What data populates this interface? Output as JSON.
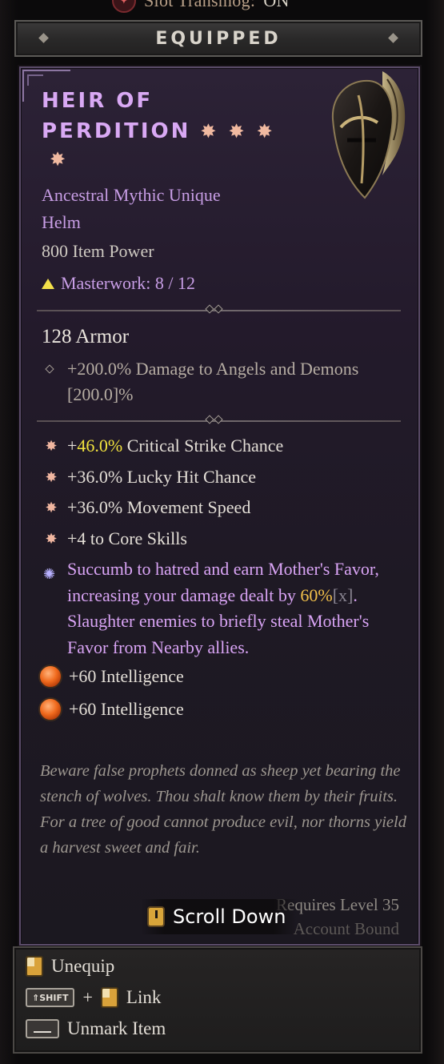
{
  "top_bar": {
    "label": "Slot Transmog:",
    "value": "ON",
    "icon": "transmog-icon"
  },
  "header": {
    "title": "EQUIPPED"
  },
  "item": {
    "name_line1": "HEIR OF",
    "name_line2": "PERDITION",
    "stars": 4,
    "rarity": "Ancestral Mythic Unique",
    "type": "Helm",
    "item_power": "800 Item Power",
    "masterwork": "Masterwork: 8 / 12",
    "armor": "128 Armor",
    "implicit": "+200.0% Damage to Angels and Demons [200.0]%",
    "affixes": [
      {
        "prefix": "+",
        "highlight": "46.0%",
        "text": " Critical Strike Chance"
      },
      {
        "prefix": "",
        "highlight": "",
        "text": "+36.0% Lucky Hit Chance"
      },
      {
        "prefix": "",
        "highlight": "",
        "text": "+36.0% Movement Speed"
      },
      {
        "prefix": "",
        "highlight": "",
        "text": "+4 to Core Skills"
      }
    ],
    "unique_power": {
      "part1": "Succumb to hatred and earn Mother's Favor, increasing your damage dealt by ",
      "value": "60%",
      "bracket": "[x]",
      "part2": ". Slaughter enemies to briefly steal Mother's Favor from Nearby allies."
    },
    "sockets": [
      {
        "text": "+60 Intelligence",
        "icon": "ruby-gem-icon"
      },
      {
        "text": "+60 Intelligence",
        "icon": "ruby-gem-icon"
      }
    ],
    "flavor": "Beware false prophets donned as sheep yet bearing the stench of wolves. Thou shalt know them by their fruits. For a tree of good cannot produce evil, nor thorns yield a harvest sweet and fair.",
    "requirement": "Requires Level 35",
    "bound": "Account Bound"
  },
  "scroll_hint": {
    "label": "Scroll Down",
    "icon": "mouse-icon"
  },
  "controls": {
    "unequip": "Unequip",
    "shift_key": "SHIFT",
    "plus": "+",
    "link": "Link",
    "unmark": "Unmark Item"
  },
  "colors": {
    "unique": "#d9a9f4",
    "highlight": "#f2e33e",
    "gold": "#f2c04a"
  }
}
